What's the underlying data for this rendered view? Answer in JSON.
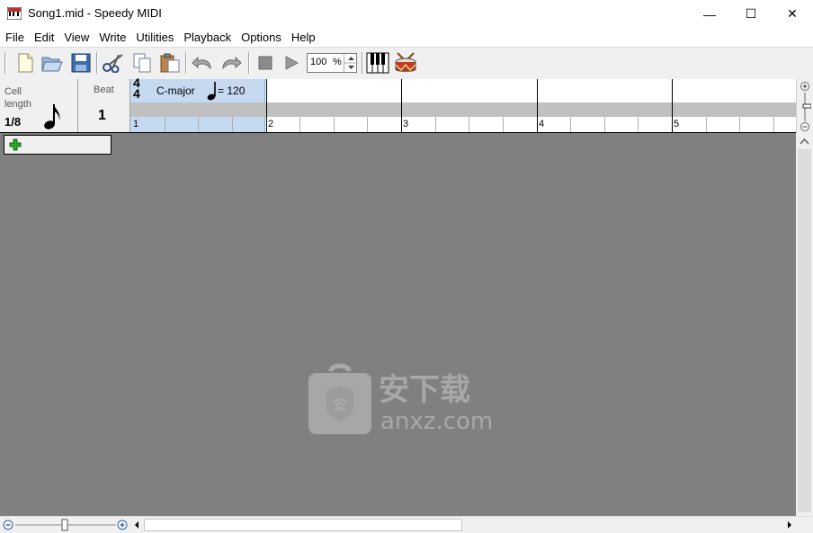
{
  "window": {
    "title": "Song1.mid - Speedy MIDI",
    "minimize_glyph": "—",
    "maximize_glyph": "☐",
    "close_glyph": "✕"
  },
  "menu": [
    "File",
    "Edit",
    "View",
    "Write",
    "Utilities",
    "Playback",
    "Options",
    "Help"
  ],
  "toolbar": {
    "buttons": [
      "new-file-icon",
      "open-folder-icon",
      "save-disk-icon",
      "cut-scissors-icon",
      "copy-icon",
      "paste-icon",
      "undo-icon",
      "redo-icon",
      "stop-icon",
      "play-icon",
      "piano-icon",
      "drum-icon"
    ],
    "zoom_value": "100",
    "zoom_unit": "%"
  },
  "header": {
    "cell_label_1": "Cell",
    "cell_label_2": "length",
    "cell_value": "1/8",
    "beat_label": "Beat",
    "beat_value": "1",
    "time_sig_top": "4",
    "time_sig_bottom": "4",
    "key": "C-major",
    "tempo_text": "= 120",
    "measures": [
      "1",
      "2",
      "3",
      "4",
      "5"
    ]
  },
  "watermark": {
    "text_cn": "安下载",
    "text_en": "anxz.com"
  },
  "colors": {
    "canvas": "#808080",
    "selection": "#c5d9f1",
    "plus_green": "#2aa82a"
  }
}
